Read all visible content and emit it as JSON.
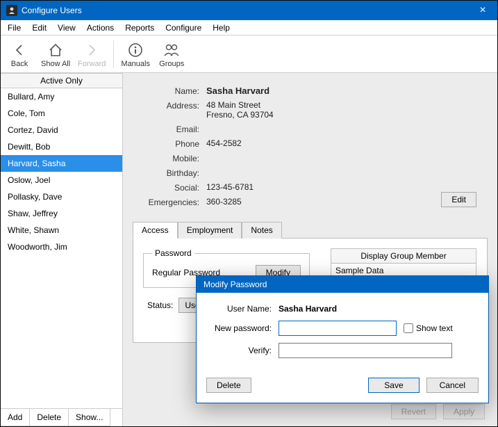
{
  "window": {
    "title": "Configure Users"
  },
  "menubar": [
    "File",
    "Edit",
    "View",
    "Actions",
    "Reports",
    "Configure",
    "Help"
  ],
  "toolbar": {
    "back": "Back",
    "show_all": "Show All",
    "forward": "Forward",
    "manuals": "Manuals",
    "groups": "Groups"
  },
  "sidebar": {
    "header": "Active Only",
    "users": [
      "Bullard, Amy",
      "Cole, Tom",
      "Cortez, David",
      "Dewitt, Bob",
      "Harvard, Sasha",
      "Oslow, Joel",
      "Pollasky, Dave",
      "Shaw, Jeffrey",
      "White, Shawn",
      "Woodworth, Jim"
    ],
    "selected_index": 4,
    "buttons": {
      "add": "Add",
      "delete": "Delete",
      "show": "Show..."
    }
  },
  "details": {
    "labels": {
      "name": "Name:",
      "address": "Address:",
      "email": "Email:",
      "phone": "Phone",
      "mobile": "Mobile:",
      "birthday": "Birthday:",
      "social": "Social:",
      "emergencies": "Emergencies:"
    },
    "name": "Sasha Harvard",
    "address_line1": "48 Main Street",
    "address_line2": "Fresno, CA 93704",
    "email": "",
    "phone": "454-2582",
    "mobile": "",
    "birthday": "",
    "social": "123-45-6781",
    "emergencies": "360-3285",
    "edit_label": "Edit"
  },
  "tabs": {
    "items": [
      "Access",
      "Employment",
      "Notes"
    ],
    "active": 0,
    "password_group": {
      "legend": "Password",
      "regular": "Regular Password",
      "modify": "Modify"
    },
    "display_group": {
      "header": "Display Group Member",
      "item": "Sample Data"
    },
    "status_label": "Status:",
    "status_value": "User"
  },
  "footer": {
    "revert": "Revert",
    "apply": "Apply"
  },
  "dialog": {
    "title": "Modify Password",
    "user_name_label": "User Name:",
    "user_name": "Sasha Harvard",
    "new_password_label": "New password:",
    "new_password_value": "",
    "verify_label": "Verify:",
    "verify_value": "",
    "show_text": "Show text",
    "show_text_checked": false,
    "delete": "Delete",
    "save": "Save",
    "cancel": "Cancel"
  }
}
